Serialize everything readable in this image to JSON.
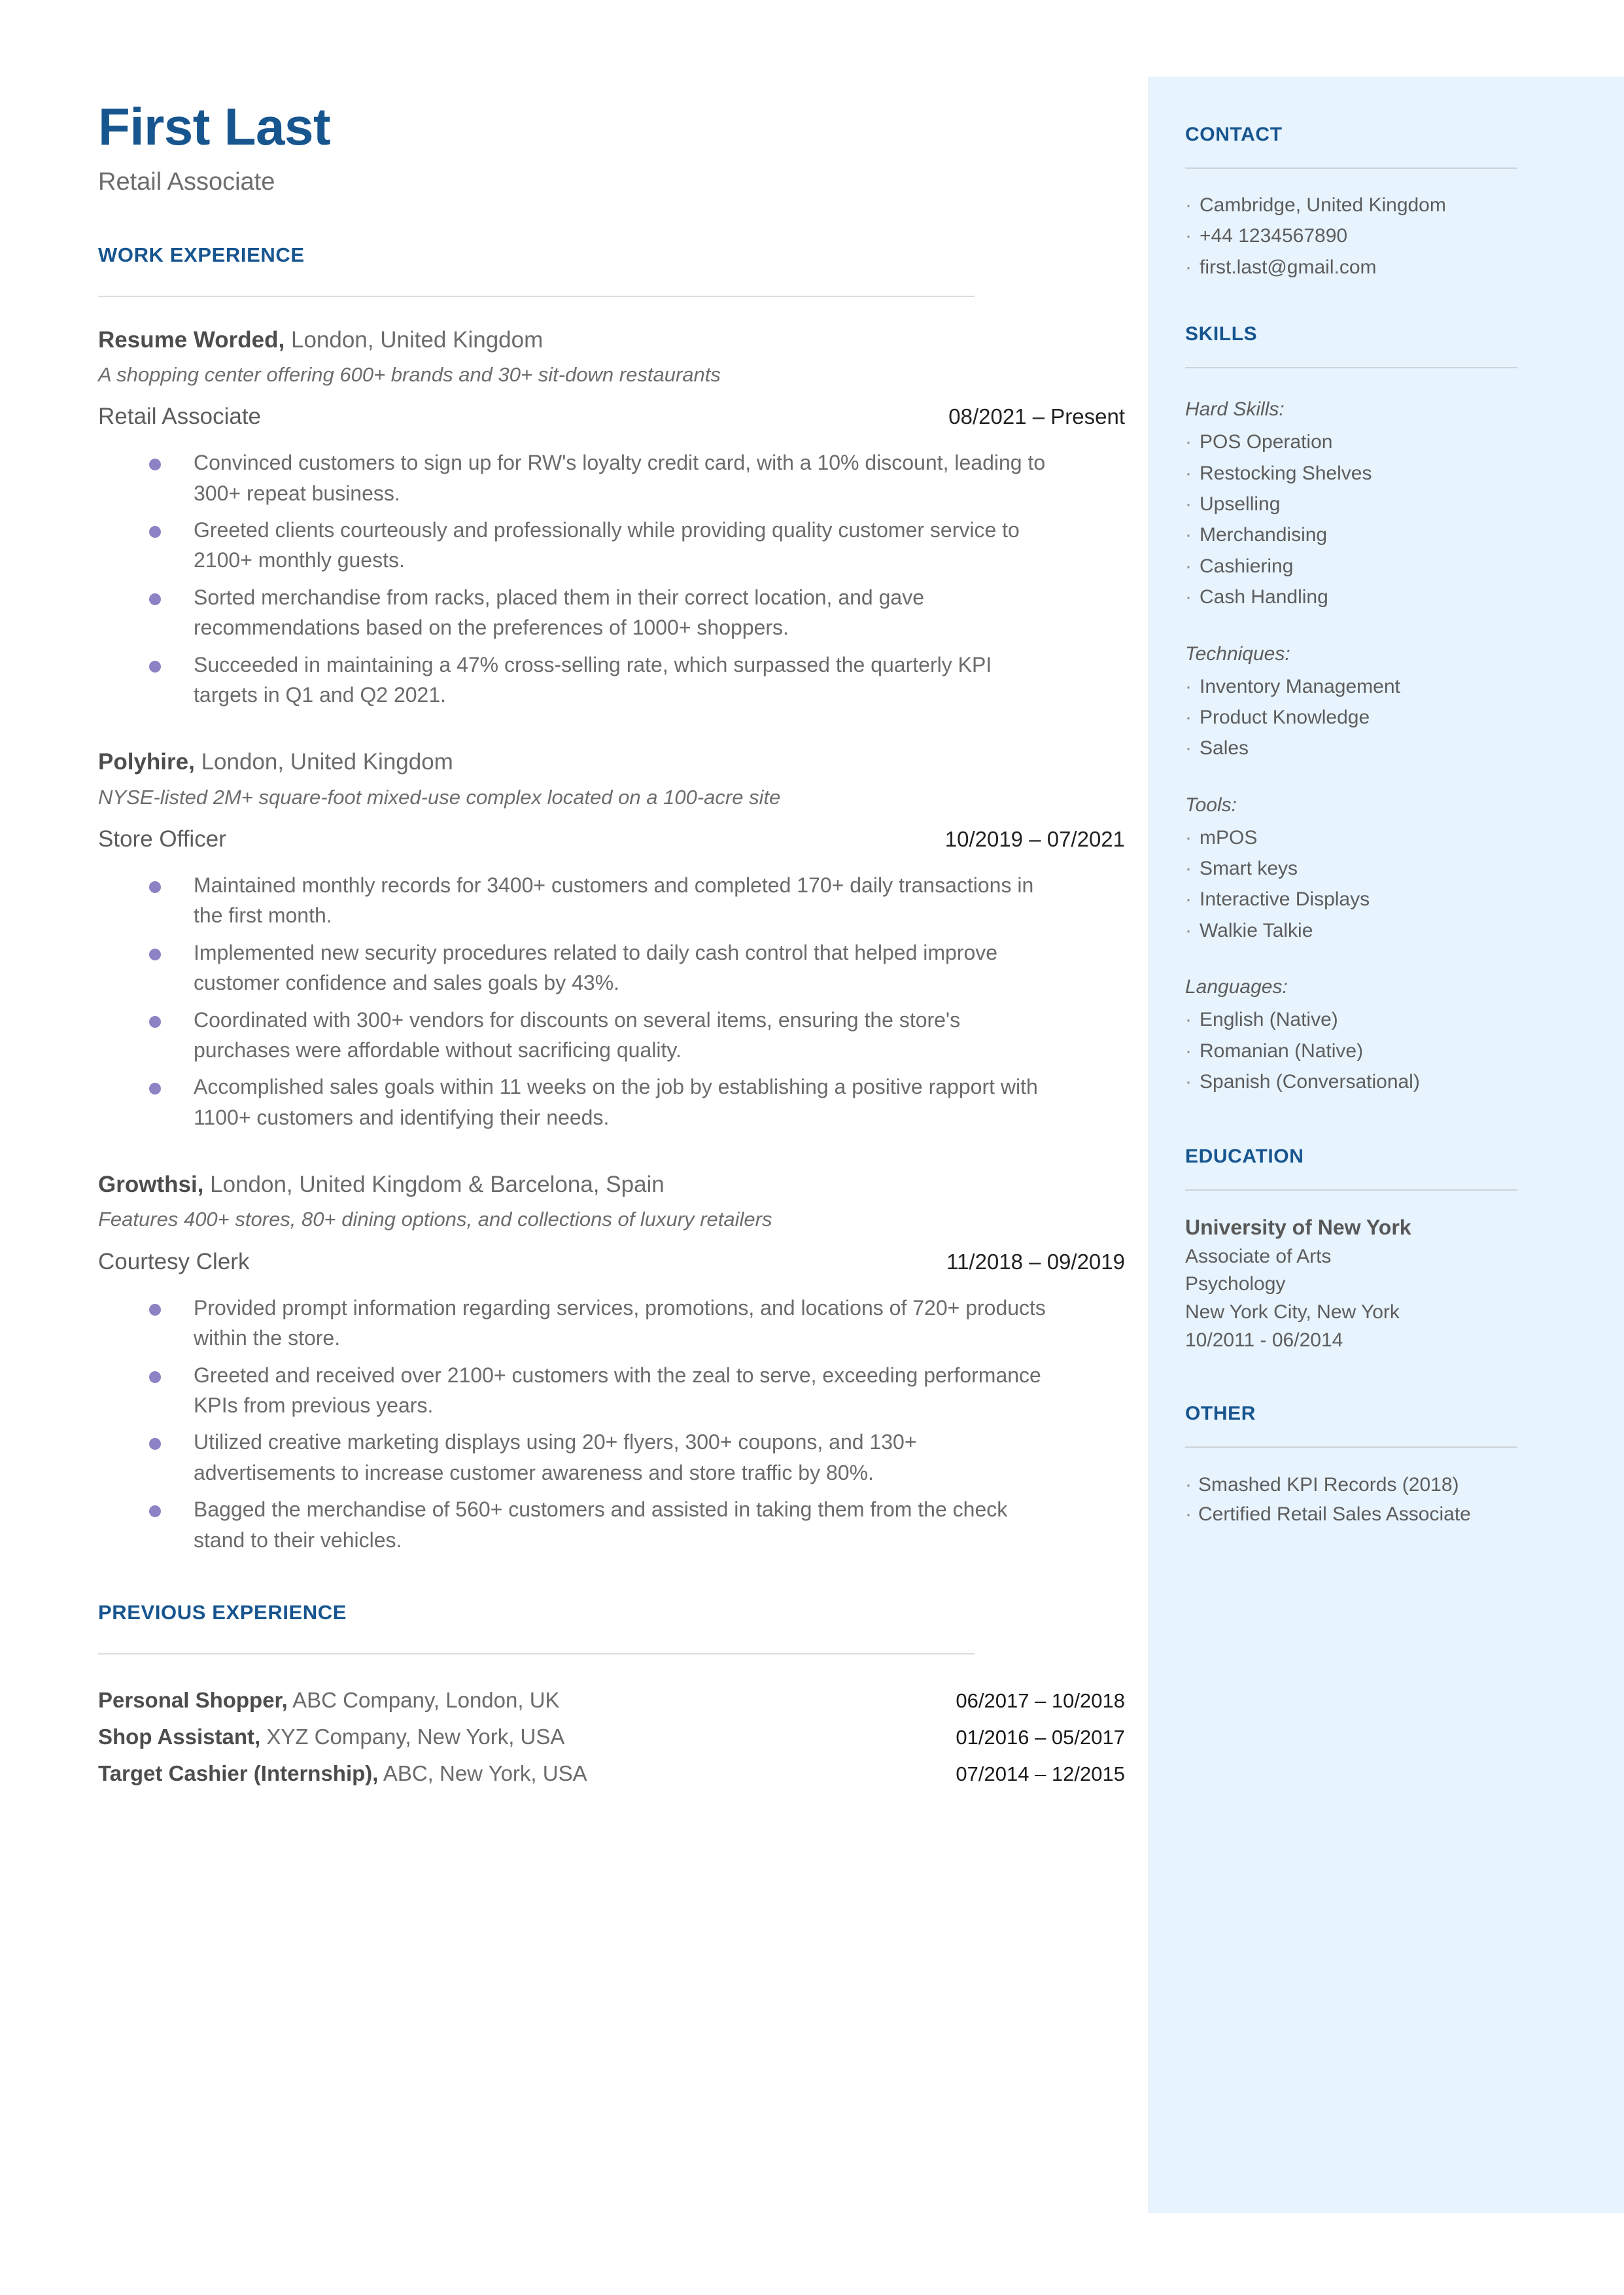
{
  "theme": {
    "accent_blue": "#17558f",
    "sidebar_bg": "#e7f3fd",
    "bullet_purple": "#8d82c4",
    "body_gray": "#6b6b6b"
  },
  "header": {
    "name": "First Last",
    "subtitle": "Retail Associate"
  },
  "work_experience": {
    "heading": "WORK EXPERIENCE",
    "jobs": [
      {
        "company": "Resume Worded,",
        "location": "London, United Kingdom",
        "description": "A shopping center offering 600+ brands and 30+ sit-down restaurants",
        "title": "Retail Associate",
        "dates": "08/2021 – Present",
        "bullets": [
          "Convinced customers to sign up for RW's loyalty credit card, with a 10% discount, leading to 300+ repeat business.",
          "Greeted clients courteously and professionally while providing quality customer service to 2100+ monthly guests.",
          "Sorted merchandise from racks, placed them in their correct location, and gave recommendations based on the preferences of 1000+ shoppers.",
          "Succeeded in maintaining a 47% cross-selling rate, which surpassed the quarterly KPI targets in Q1 and Q2 2021."
        ]
      },
      {
        "company": "Polyhire,",
        "location": "London, United Kingdom",
        "description": "NYSE-listed 2M+ square-foot mixed-use complex located on a 100-acre site",
        "title": "Store Officer",
        "dates": "10/2019 – 07/2021",
        "bullets": [
          "Maintained monthly records for 3400+ customers and completed 170+ daily transactions in the first month.",
          "Implemented new security procedures related to daily cash control that helped improve customer confidence and sales goals by 43%.",
          "Coordinated with 300+ vendors for discounts on several items, ensuring the store's purchases were affordable without sacrificing quality.",
          "Accomplished sales goals within 11 weeks on the job by establishing a positive rapport with 1100+ customers and identifying their needs."
        ]
      },
      {
        "company": "Growthsi,",
        "location": "London, United Kingdom & Barcelona, Spain",
        "description": "Features 400+ stores, 80+ dining options, and collections of luxury retailers",
        "title": "Courtesy Clerk",
        "dates": "11/2018 – 09/2019",
        "bullets": [
          "Provided prompt information regarding services, promotions, and locations of 720+ products within the store.",
          "Greeted and received over 2100+ customers with the zeal to serve, exceeding performance KPIs from previous years.",
          "Utilized creative marketing displays using 20+ flyers, 300+ coupons, and 130+ advertisements to increase customer awareness and store traffic by 80%.",
          "Bagged the merchandise of 560+ customers and assisted in taking them from the check stand to their vehicles."
        ]
      }
    ]
  },
  "previous_experience": {
    "heading": "PREVIOUS EXPERIENCE",
    "rows": [
      {
        "role": "Personal Shopper,",
        "detail": "ABC Company, London, UK",
        "dates": "06/2017 – 10/2018"
      },
      {
        "role": "Shop Assistant,",
        "detail": "XYZ Company, New York, USA",
        "dates": "01/2016 – 05/2017"
      },
      {
        "role": "Target Cashier (Internship),",
        "detail": "ABC, New York, USA",
        "dates": "07/2014 – 12/2015"
      }
    ]
  },
  "sidebar": {
    "contact": {
      "heading": "CONTACT",
      "items": [
        "Cambridge, United Kingdom",
        "+44 1234567890",
        "first.last@gmail.com"
      ]
    },
    "skills": {
      "heading": "SKILLS",
      "groups": [
        {
          "label": "Hard Skills:",
          "items": [
            "POS Operation",
            "Restocking Shelves",
            "Upselling",
            "Merchandising",
            "Cashiering",
            "Cash Handling"
          ]
        },
        {
          "label": "Techniques:",
          "items": [
            "Inventory Management",
            "Product Knowledge",
            "Sales"
          ]
        },
        {
          "label": "Tools:",
          "items": [
            "mPOS",
            "Smart keys",
            "Interactive Displays",
            "Walkie Talkie"
          ]
        },
        {
          "label": "Languages:",
          "items": [
            "English (Native)",
            "Romanian (Native)",
            "Spanish (Conversational)"
          ]
        }
      ]
    },
    "education": {
      "heading": "EDUCATION",
      "school": "University of New York",
      "degree": "Associate of Arts",
      "field": "Psychology",
      "location": "New York City, New York",
      "dates": "10/2011 - 06/2014"
    },
    "other": {
      "heading": "OTHER",
      "items": [
        "Smashed KPI Records (2018)",
        "Certified Retail Sales Associate"
      ]
    }
  }
}
